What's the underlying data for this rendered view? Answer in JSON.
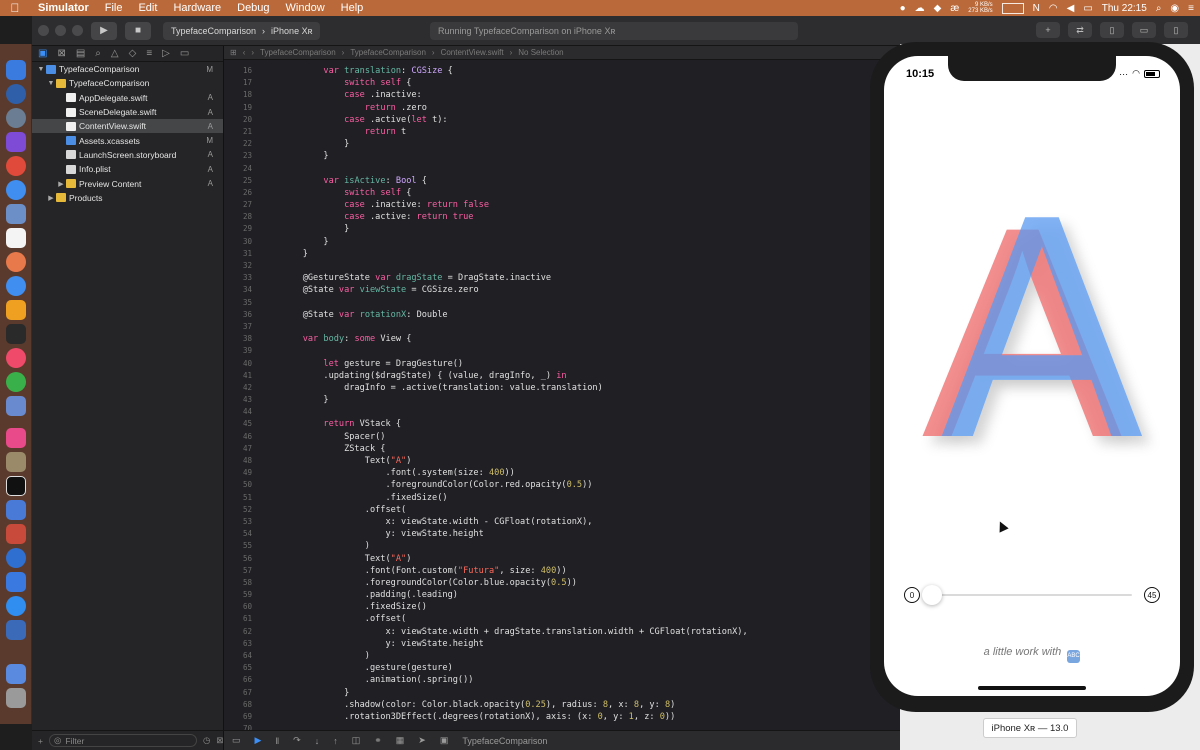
{
  "menubar": {
    "app": "Simulator",
    "items": [
      "File",
      "Edit",
      "Hardware",
      "Debug",
      "Window",
      "Help"
    ],
    "net_up": "9 KB/s",
    "net_down": "273 KB/s",
    "clock": "Thu 22:15"
  },
  "toolbar": {
    "scheme": "TypefaceComparison",
    "destination": "iPhone Xʀ",
    "activity": "Running TypefaceComparison on iPhone Xʀ"
  },
  "navigator": {
    "rows": [
      {
        "label": "TypefaceComparison",
        "status": "M",
        "indent": 0,
        "icon": "blue",
        "arrow": "▼"
      },
      {
        "label": "TypefaceComparison",
        "status": "",
        "indent": 1,
        "icon": "folder",
        "arrow": "▼"
      },
      {
        "label": "AppDelegate.swift",
        "status": "A",
        "indent": 2,
        "icon": "swift",
        "arrow": ""
      },
      {
        "label": "SceneDelegate.swift",
        "status": "A",
        "indent": 2,
        "icon": "swift",
        "arrow": ""
      },
      {
        "label": "ContentView.swift",
        "status": "A",
        "indent": 2,
        "icon": "swift",
        "arrow": "",
        "selected": true
      },
      {
        "label": "Assets.xcassets",
        "status": "M",
        "indent": 2,
        "icon": "blue",
        "arrow": ""
      },
      {
        "label": "LaunchScreen.storyboard",
        "status": "A",
        "indent": 2,
        "icon": "file",
        "arrow": ""
      },
      {
        "label": "Info.plist",
        "status": "A",
        "indent": 2,
        "icon": "file",
        "arrow": ""
      },
      {
        "label": "Preview Content",
        "status": "A",
        "indent": 2,
        "icon": "folder",
        "arrow": "▶"
      },
      {
        "label": "Products",
        "status": "",
        "indent": 1,
        "icon": "folder",
        "arrow": "▶"
      }
    ],
    "filter_placeholder": "Filter"
  },
  "jumpbar": {
    "crumbs": [
      "TypefaceComparison",
      "TypefaceComparison",
      "ContentView.swift",
      "No Selection"
    ]
  },
  "editor": {
    "first_line": 16,
    "lines": [
      [
        [
          "        ",
          ""
        ],
        [
          "var",
          "kw"
        ],
        [
          " ",
          ""
        ],
        [
          "translation",
          "id"
        ],
        [
          ": ",
          ""
        ],
        [
          "CGSize",
          "ty"
        ],
        [
          " {",
          ""
        ]
      ],
      [
        [
          "            ",
          ""
        ],
        [
          "switch",
          "kw"
        ],
        [
          " ",
          ""
        ],
        [
          "self",
          "kw"
        ],
        [
          " {",
          ""
        ]
      ],
      [
        [
          "            ",
          ""
        ],
        [
          "case",
          "kw"
        ],
        [
          " .inactive:",
          ""
        ]
      ],
      [
        [
          "                ",
          ""
        ],
        [
          "return",
          "kw"
        ],
        [
          " .zero",
          ""
        ]
      ],
      [
        [
          "            ",
          ""
        ],
        [
          "case",
          "kw"
        ],
        [
          " .active(",
          ""
        ],
        [
          "let",
          "kw"
        ],
        [
          " t):",
          ""
        ]
      ],
      [
        [
          "                ",
          ""
        ],
        [
          "return",
          "kw"
        ],
        [
          " t",
          ""
        ]
      ],
      [
        [
          "            }",
          ""
        ]
      ],
      [
        [
          "        }",
          ""
        ]
      ],
      [
        [
          "",
          ""
        ]
      ],
      [
        [
          "        ",
          ""
        ],
        [
          "var",
          "kw"
        ],
        [
          " ",
          ""
        ],
        [
          "isActive",
          "id"
        ],
        [
          ": ",
          ""
        ],
        [
          "Bool",
          "ty"
        ],
        [
          " {",
          ""
        ]
      ],
      [
        [
          "            ",
          ""
        ],
        [
          "switch",
          "kw"
        ],
        [
          " ",
          ""
        ],
        [
          "self",
          "kw"
        ],
        [
          " {",
          ""
        ]
      ],
      [
        [
          "            ",
          ""
        ],
        [
          "case",
          "kw"
        ],
        [
          " .inactive: ",
          ""
        ],
        [
          "return",
          "kw"
        ],
        [
          " ",
          ""
        ],
        [
          "false",
          "kw"
        ]
      ],
      [
        [
          "            ",
          ""
        ],
        [
          "case",
          "kw"
        ],
        [
          " .active: ",
          ""
        ],
        [
          "return",
          "kw"
        ],
        [
          " ",
          ""
        ],
        [
          "true",
          "kw"
        ]
      ],
      [
        [
          "            }",
          ""
        ]
      ],
      [
        [
          "        }",
          ""
        ]
      ],
      [
        [
          "    }",
          ""
        ]
      ],
      [
        [
          "",
          ""
        ]
      ],
      [
        [
          "    @GestureState ",
          ""
        ],
        [
          "var",
          "kw"
        ],
        [
          " ",
          ""
        ],
        [
          "dragState",
          "id"
        ],
        [
          " = DragState.inactive",
          ""
        ]
      ],
      [
        [
          "    @State ",
          ""
        ],
        [
          "var",
          "kw"
        ],
        [
          " ",
          ""
        ],
        [
          "viewState",
          "id"
        ],
        [
          " = CGSize.zero",
          ""
        ]
      ],
      [
        [
          "",
          ""
        ]
      ],
      [
        [
          "    @State ",
          ""
        ],
        [
          "var",
          "kw"
        ],
        [
          " ",
          ""
        ],
        [
          "rotationX",
          "id"
        ],
        [
          ": Double",
          ""
        ]
      ],
      [
        [
          "",
          ""
        ]
      ],
      [
        [
          "    ",
          ""
        ],
        [
          "var",
          "kw"
        ],
        [
          " ",
          ""
        ],
        [
          "body",
          "id"
        ],
        [
          ": ",
          ""
        ],
        [
          "some",
          "kw"
        ],
        [
          " View {",
          ""
        ]
      ],
      [
        [
          "",
          ""
        ]
      ],
      [
        [
          "        ",
          ""
        ],
        [
          "let",
          "kw"
        ],
        [
          " gesture = DragGesture()",
          ""
        ]
      ],
      [
        [
          "        .updating($dragState) { (value, dragInfo, _) ",
          ""
        ],
        [
          "in",
          "kw"
        ]
      ],
      [
        [
          "            dragInfo = .active(translation: value.translation)",
          ""
        ]
      ],
      [
        [
          "        }",
          ""
        ]
      ],
      [
        [
          "",
          ""
        ]
      ],
      [
        [
          "        ",
          ""
        ],
        [
          "return",
          "kw"
        ],
        [
          " VStack {",
          ""
        ]
      ],
      [
        [
          "            Spacer()",
          ""
        ]
      ],
      [
        [
          "            ZStack {",
          ""
        ]
      ],
      [
        [
          "                Text(",
          ""
        ],
        [
          "\"A\"",
          "st"
        ],
        [
          ")",
          ""
        ]
      ],
      [
        [
          "                    .font(.system(size: ",
          ""
        ],
        [
          "400",
          "nm"
        ],
        [
          "))",
          ""
        ]
      ],
      [
        [
          "                    .foregroundColor(Color.red.opacity(",
          ""
        ],
        [
          "0.5",
          "nm"
        ],
        [
          "))",
          ""
        ]
      ],
      [
        [
          "                    .fixedSize()",
          ""
        ]
      ],
      [
        [
          "                .offset(",
          ""
        ]
      ],
      [
        [
          "                    x: viewState.width - CGFloat(rotationX),",
          ""
        ]
      ],
      [
        [
          "                    y: viewState.height",
          ""
        ]
      ],
      [
        [
          "                )",
          ""
        ]
      ],
      [
        [
          "                Text(",
          ""
        ],
        [
          "\"A\"",
          "st"
        ],
        [
          ")",
          ""
        ]
      ],
      [
        [
          "                .font(Font.custom(",
          ""
        ],
        [
          "\"Futura\"",
          "st"
        ],
        [
          ", size: ",
          ""
        ],
        [
          "400",
          "nm"
        ],
        [
          "))",
          ""
        ]
      ],
      [
        [
          "                .foregroundColor(Color.blue.opacity(",
          ""
        ],
        [
          "0.5",
          "nm"
        ],
        [
          "))",
          ""
        ]
      ],
      [
        [
          "                .padding(.leading)",
          ""
        ]
      ],
      [
        [
          "                .fixedSize()",
          ""
        ]
      ],
      [
        [
          "                .offset(",
          ""
        ]
      ],
      [
        [
          "                    x: viewState.width + dragState.translation.width + CGFloat(rotationX),",
          ""
        ]
      ],
      [
        [
          "                    y: viewState.height",
          ""
        ]
      ],
      [
        [
          "                )",
          ""
        ]
      ],
      [
        [
          "                .gesture(gesture)",
          ""
        ]
      ],
      [
        [
          "                .animation(.spring())",
          ""
        ]
      ],
      [
        [
          "            }",
          ""
        ]
      ],
      [
        [
          "            .shadow(color: Color.black.opacity(",
          ""
        ],
        [
          "0.25",
          "nm"
        ],
        [
          "), radius: ",
          ""
        ],
        [
          "8",
          "nm"
        ],
        [
          ", x: ",
          ""
        ],
        [
          "8",
          "nm"
        ],
        [
          ", y: ",
          ""
        ],
        [
          "8",
          "nm"
        ],
        [
          ")",
          ""
        ]
      ],
      [
        [
          "            .rotation3DEffect(.degrees(rotationX), axis: (x: ",
          ""
        ],
        [
          "0",
          "nm"
        ],
        [
          ", y: ",
          ""
        ],
        [
          "1",
          "nm"
        ],
        [
          ", z: ",
          ""
        ],
        [
          "0",
          "nm"
        ],
        [
          "))",
          ""
        ]
      ],
      [
        [
          "",
          ""
        ]
      ]
    ]
  },
  "debugbar": {
    "target": "TypefaceComparison"
  },
  "simulator": {
    "status_time": "10:15",
    "slider_min": "0",
    "slider_max": "45",
    "slider_value": 0,
    "caption": "a little work with",
    "caption_emoji": "ABCD",
    "glyph": "A",
    "colors": {
      "red_glyph": "#ee6a6a",
      "blue_glyph": "#5a9af0"
    },
    "device_label": "iPhone Xʀ — 13.0"
  }
}
